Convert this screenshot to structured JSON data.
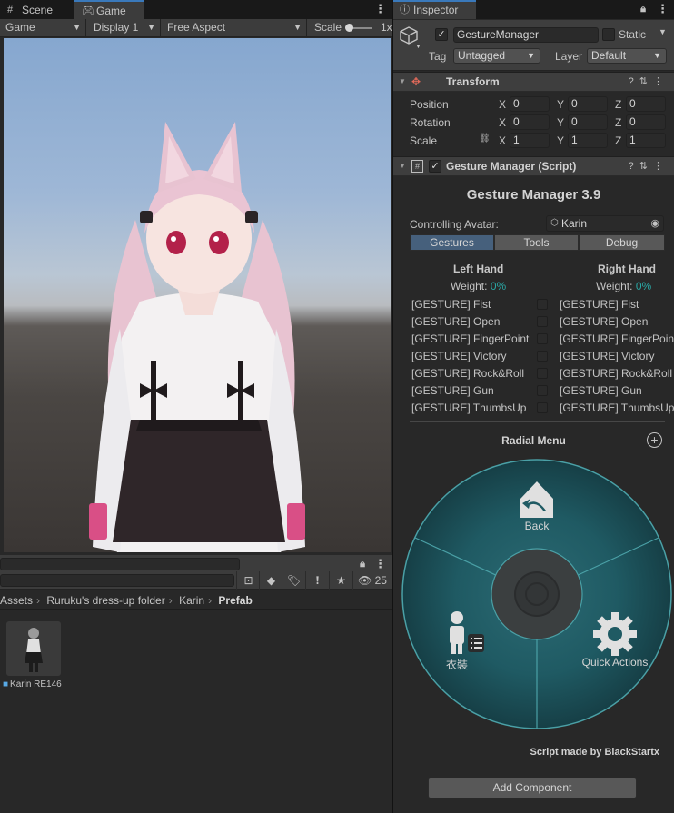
{
  "scene_tabs": {
    "scene": "Scene",
    "game": "Game"
  },
  "game_toolbar": {
    "mode": "Game",
    "display": "Display 1",
    "aspect": "Free Aspect",
    "scale_label": "Scale",
    "scale_value": "1x"
  },
  "project": {
    "filter_count": "25",
    "breadcrumb": [
      "Assets",
      "Ruruku's dress-up folder",
      "Karin",
      "Prefab"
    ],
    "asset_name": "Karin RE146"
  },
  "inspector": {
    "tab": "Inspector",
    "object_name": "GestureManager",
    "static_label": "Static",
    "tag_label": "Tag",
    "tag_value": "Untagged",
    "layer_label": "Layer",
    "layer_value": "Default",
    "transform": {
      "title": "Transform",
      "rows": [
        {
          "label": "Position",
          "x": "0",
          "y": "0",
          "z": "0"
        },
        {
          "label": "Rotation",
          "x": "0",
          "y": "0",
          "z": "0"
        },
        {
          "label": "Scale",
          "x": "1",
          "y": "1",
          "z": "1"
        }
      ]
    },
    "script_component": "Gesture Manager (Script)"
  },
  "gesture_manager": {
    "title": "Gesture Manager 3.9",
    "avatar_label": "Controlling Avatar:",
    "avatar_value": "Karin",
    "tabs": [
      "Gestures",
      "Tools",
      "Debug"
    ],
    "left_hand": "Left Hand",
    "right_hand": "Right Hand",
    "weight_label": "Weight:",
    "left_weight": "0%",
    "right_weight": "0%",
    "gestures": [
      "[GESTURE] Fist",
      "[GESTURE] Open",
      "[GESTURE] FingerPoint",
      "[GESTURE] Victory",
      "[GESTURE] Rock&Roll",
      "[GESTURE] Gun",
      "[GESTURE] ThumbsUp"
    ],
    "radial_title": "Radial Menu",
    "radial_back": "Back",
    "radial_outfit": "衣裝",
    "radial_quick": "Quick Actions",
    "credit": "Script made by BlackStartx",
    "add_component": "Add Component"
  },
  "colors": {
    "accent_tab": "#3a79bb",
    "active_segment": "#46607c",
    "weight_teal": "#2aa7a4",
    "radial_teal": "#1f5a63"
  }
}
